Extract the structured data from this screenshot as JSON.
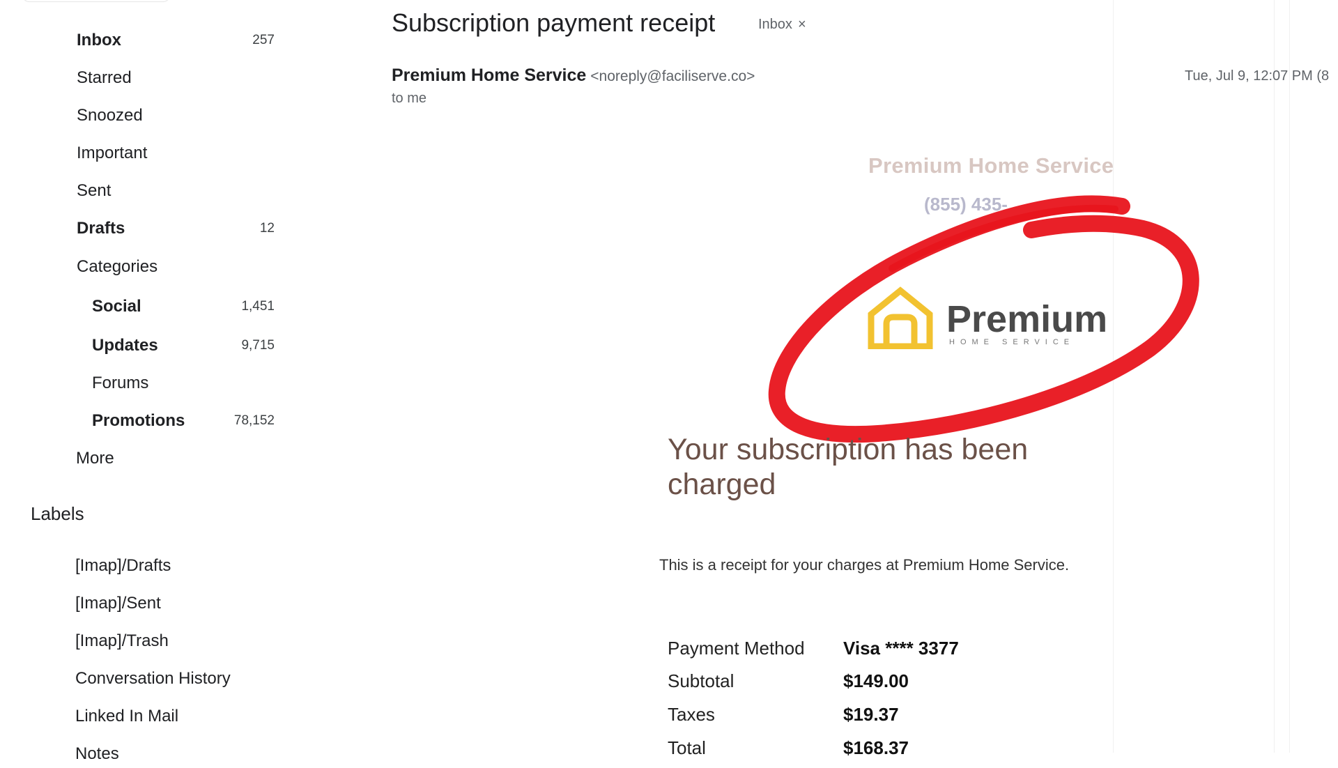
{
  "sidebar": {
    "nav": [
      {
        "label": "Inbox",
        "count": "257",
        "bold": true
      },
      {
        "label": "Starred",
        "count": "",
        "bold": false
      },
      {
        "label": "Snoozed",
        "count": "",
        "bold": false
      },
      {
        "label": "Important",
        "count": "",
        "bold": false
      },
      {
        "label": "Sent",
        "count": "",
        "bold": false
      },
      {
        "label": "Drafts",
        "count": "12",
        "bold": true
      },
      {
        "label": "Categories",
        "count": "",
        "bold": false
      }
    ],
    "categories": [
      {
        "label": "Social",
        "count": "1,451",
        "bold": true
      },
      {
        "label": "Updates",
        "count": "9,715",
        "bold": true
      },
      {
        "label": "Forums",
        "count": "",
        "bold": false
      },
      {
        "label": "Promotions",
        "count": "78,152",
        "bold": true
      }
    ],
    "more": "More",
    "labels_heading": "Labels",
    "labels": [
      "[Imap]/Drafts",
      "[Imap]/Sent",
      "[Imap]/Trash",
      "Conversation History",
      "Linked In Mail",
      "Notes"
    ]
  },
  "email": {
    "subject": "Subscription payment receipt",
    "chip_label": "Inbox",
    "chip_close": "×",
    "sender_name": "Premium Home Service",
    "sender_email": "<noreply@faciliserve.co>",
    "recipient": "to me",
    "date": "Tue, Jul 9, 12:07 PM (8"
  },
  "body": {
    "brand_name": "Premium Home Service",
    "brand_phone": "(855) 435-",
    "logo_word": "Premium",
    "logo_sub": "HOME SERVICE",
    "headline": "Your subscription has been charged",
    "receipt_text": "This is a receipt for your charges at Premium Home Service.",
    "rows": [
      {
        "label": "Payment Method",
        "value": "Visa **** 3377"
      },
      {
        "label": "Subtotal",
        "value": "$149.00"
      },
      {
        "label": "Taxes",
        "value": "$19.37"
      },
      {
        "label": "Total",
        "value": "$168.37"
      }
    ]
  },
  "colors": {
    "logo_gold": "#f2c230",
    "circle_red": "#e8141c",
    "headline_brown": "#6b5148"
  },
  "icons": {
    "chip_close": "close-icon",
    "logo": "house-icon"
  }
}
